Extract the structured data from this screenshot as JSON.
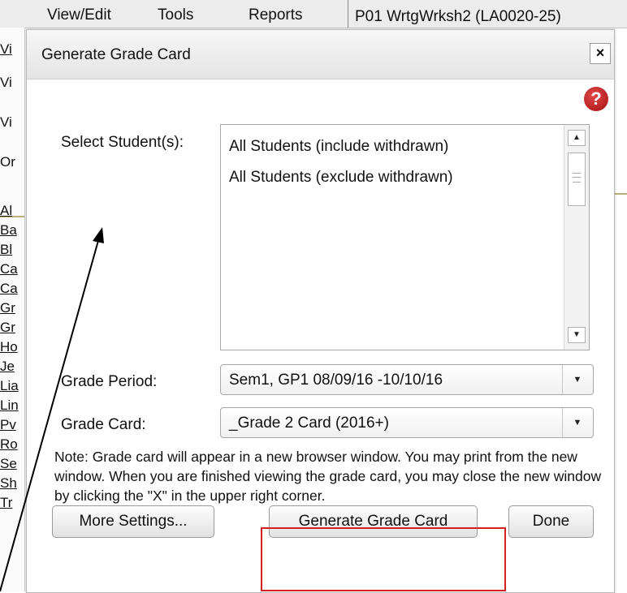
{
  "menubar": {
    "items": [
      "View/Edit",
      "Tools",
      "Reports"
    ],
    "class_title": "P01  WrtgWrksh2 (LA0020-25)"
  },
  "left_links": [
    "Vi",
    "Vi",
    "Vi",
    "Or",
    "Al",
    "Ba",
    "Bl",
    "Ca",
    "Ca",
    "Gr",
    "Gr",
    "Ho",
    "Je",
    "Lia",
    "Lin",
    "Pv",
    "Ro",
    "Se",
    "Sh",
    "Tr"
  ],
  "dialog": {
    "title": "Generate Grade Card",
    "close_label": "×",
    "help_label": "?",
    "select_students_label": "Select Student(s):",
    "student_options": [
      "All Students (include withdrawn)",
      "All Students (exclude withdrawn)"
    ],
    "grade_period_label": "Grade Period:",
    "grade_period_value": "Sem1, GP1  08/09/16  -10/10/16",
    "grade_card_label": "Grade Card:",
    "grade_card_value": "_Grade 2 Card (2016+)",
    "note": "Note: Grade card will appear in a new browser window. You may print from the new window. When you are finished viewing the grade card, you may close the new window by clicking the \"X\" in the upper right corner.",
    "buttons": {
      "more_settings": "More Settings...",
      "generate": "Generate Grade Card",
      "done": "Done"
    }
  },
  "colors": {
    "highlight": "#d42020",
    "help_icon": "#b01a1a"
  }
}
